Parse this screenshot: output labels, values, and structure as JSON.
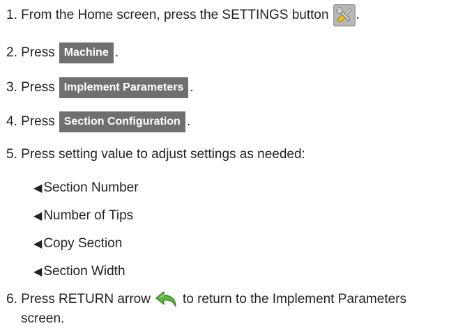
{
  "steps": [
    {
      "number": "1.",
      "text": "From the Home screen, press the SETTINGS button",
      "icon": "settings-tools-icon",
      "after": "."
    },
    {
      "number": "2.",
      "text": "Press",
      "button": "Machine",
      "after": "."
    },
    {
      "number": "3.",
      "text": "Press",
      "button": "Implement Parameters",
      "after": "."
    },
    {
      "number": "4.",
      "text": "Press",
      "button": "Section Configuration",
      "after": "."
    },
    {
      "number": "5.",
      "text": "Press setting value to adjust settings as needed:"
    },
    {
      "number": "6.",
      "text_before": "Press RETURN arrow",
      "icon": "return-arrow-icon",
      "text_after": "to return to the Implement Parameters",
      "continuation": "screen."
    }
  ],
  "sub_items": [
    {
      "bullet": "◀",
      "label": "Section Number"
    },
    {
      "bullet": "◀",
      "label": "Number of Tips"
    },
    {
      "bullet": "◀",
      "label": "Copy Section"
    },
    {
      "bullet": "◀",
      "label": "Section Width"
    }
  ],
  "colors": {
    "button_bg": "#6f6f6f",
    "button_text": "#ffffff",
    "text": "#222222",
    "return_arrow": "#5fb53f"
  }
}
